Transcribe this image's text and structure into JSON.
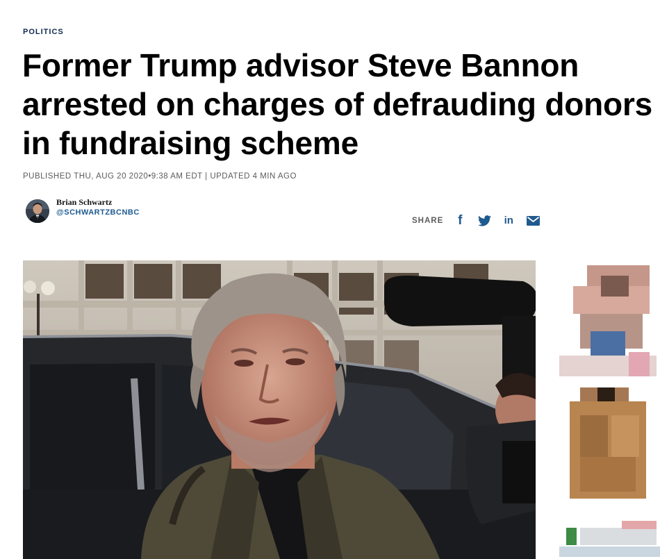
{
  "article": {
    "section": "POLITICS",
    "headline": "Former Trump advisor Steve Bannon arrested on charges of defrauding donors in fundraising scheme",
    "timestamp": "PUBLISHED THU, AUG 20 2020•9:38 AM EDT | UPDATED 4 MIN AGO",
    "author": {
      "name": "Brian Schwartz",
      "handle": "@SCHWARTZBCNBC"
    }
  },
  "share": {
    "label": "SHARE",
    "buttons": [
      {
        "icon": "facebook-icon"
      },
      {
        "icon": "twitter-icon"
      },
      {
        "icon": "linkedin-icon"
      },
      {
        "icon": "email-icon"
      }
    ]
  },
  "colors": {
    "brand_blue": "#1f5a8f",
    "section_navy": "#102a52",
    "meta_gray": "#5b5b5b"
  },
  "share_glyphs": {
    "facebook": "f",
    "linkedin": "in"
  }
}
